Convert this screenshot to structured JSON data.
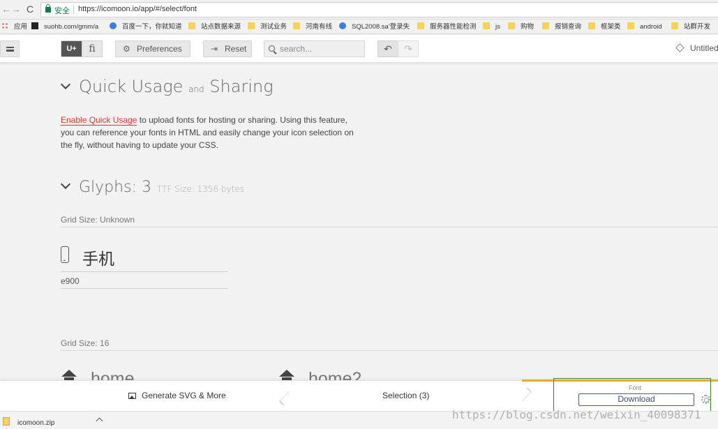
{
  "browser": {
    "nav": {
      "back": "←",
      "forward": "→",
      "reload": "C"
    },
    "secure_label": "安全",
    "url": "https://icomoon.io/app/#/select/font",
    "bookmarks": [
      {
        "label": "应用",
        "icon": "apps-icon"
      },
      {
        "label": "suohb.com/gmm/a",
        "icon": "site-icon"
      },
      {
        "label": "百度一下，你就知道",
        "icon": "paw-icon"
      },
      {
        "label": "站点数据来源",
        "icon": "folder-icon"
      },
      {
        "label": "测试业务",
        "icon": "folder-icon"
      },
      {
        "label": "河南有线",
        "icon": "folder-icon"
      },
      {
        "label": "SQL2008.sa'登录失",
        "icon": "paw-icon"
      },
      {
        "label": "服务器性能检测",
        "icon": "folder-icon"
      },
      {
        "label": "js",
        "icon": "folder-icon"
      },
      {
        "label": "购物",
        "icon": "folder-icon"
      },
      {
        "label": "报销查询",
        "icon": "folder-icon"
      },
      {
        "label": "框架类",
        "icon": "folder-icon"
      },
      {
        "label": "android",
        "icon": "folder-icon"
      },
      {
        "label": "站群开发",
        "icon": "folder-icon"
      }
    ]
  },
  "toolbar": {
    "seg_unicode": "U+",
    "seg_ligature": "fi",
    "preferences_label": "Preferences",
    "reset_label": "Reset",
    "search_placeholder": "search...",
    "undo": "↶",
    "redo": "↷",
    "project_name": "Untitled"
  },
  "quick_usage": {
    "title_a": "Quick Usage",
    "title_and": "and",
    "title_b": "Sharing",
    "link": "Enable Quick Usage",
    "text": " to upload fonts for hosting or sharing. Using this feature, you can reference your fonts in HTML and easily change your icon selection on the fly, without having to update your CSS."
  },
  "glyphs": {
    "title": "Glyphs: 3",
    "meta": "TTF Size: 1356 bytes",
    "groups": [
      {
        "grid_label": "Grid Size: Unknown",
        "items": [
          {
            "name": "手机",
            "code": "e900",
            "icon": "mobile-phone-icon"
          }
        ]
      },
      {
        "grid_label": "Grid Size: 16",
        "items": [
          {
            "name": "home",
            "icon": "home-icon"
          },
          {
            "name": "home2",
            "icon": "home-icon"
          }
        ]
      }
    ]
  },
  "bottom_bar": {
    "generate_label": "Generate SVG & More",
    "selection_label": "Selection (3)",
    "font_label": "Font",
    "download_label": "Download",
    "accent_color": "#f0a830",
    "highlight_color": "#2f8a2f"
  },
  "downloads": {
    "file": "icomoon.zip"
  },
  "watermark": "https://blog.csdn.net/weixin_40098371"
}
